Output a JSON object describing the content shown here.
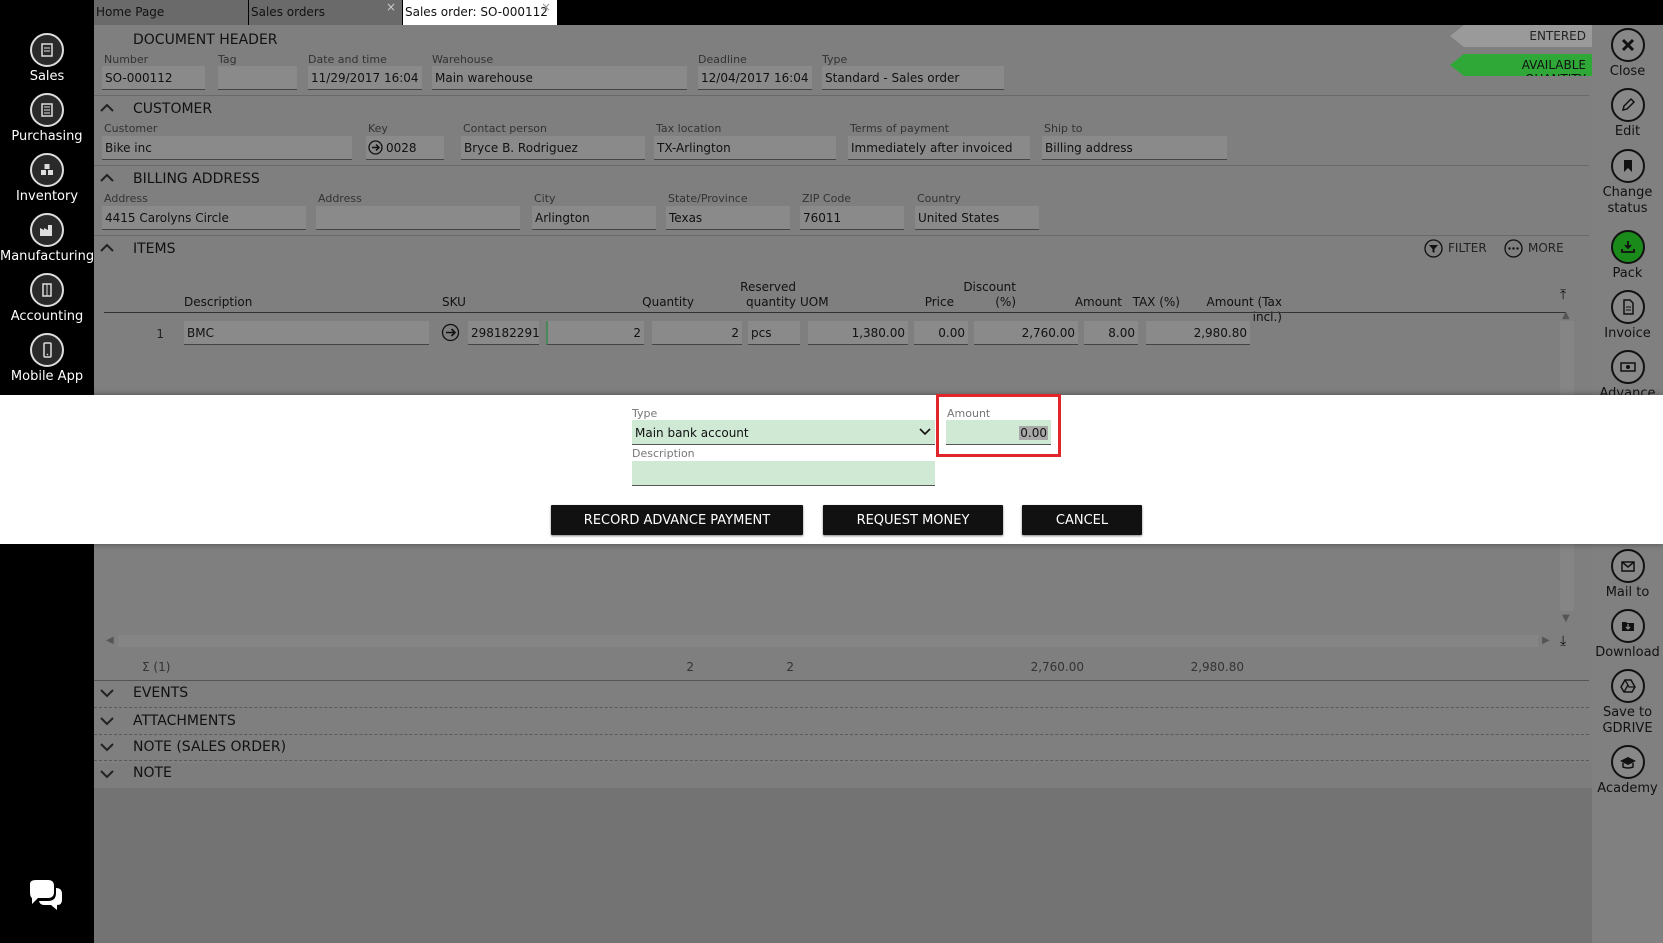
{
  "sidebar": {
    "items": [
      {
        "label": "Sales",
        "icon": "sales-icon"
      },
      {
        "label": "Purchasing",
        "icon": "purchasing-icon"
      },
      {
        "label": "Inventory",
        "icon": "inventory-icon"
      },
      {
        "label": "Manufacturing",
        "icon": "manufacturing-icon"
      },
      {
        "label": "Accounting",
        "icon": "accounting-icon"
      },
      {
        "label": "Mobile App",
        "icon": "mobile-icon"
      }
    ]
  },
  "tabs": [
    {
      "label": "Home Page"
    },
    {
      "label": "Sales orders",
      "close": "×"
    },
    {
      "label": "Sales order: SO-000112",
      "close": "×"
    }
  ],
  "status": {
    "entered": "ENTERED",
    "available": "AVAILABLE QUANTITY"
  },
  "colors": {
    "accent_green": "#2fa838",
    "highlight_red": "#e0262b",
    "field_green": "#cfe9d5"
  },
  "header": {
    "title": "DOCUMENT HEADER",
    "number_label": "Number",
    "number": "SO-000112",
    "tag_label": "Tag",
    "tag": "",
    "datetime_label": "Date and time",
    "datetime": "11/29/2017 16:04",
    "warehouse_label": "Warehouse",
    "warehouse": "Main warehouse",
    "deadline_label": "Deadline",
    "deadline": "12/04/2017 16:04",
    "type_label": "Type",
    "type": "Standard - Sales order"
  },
  "customer": {
    "title": "CUSTOMER",
    "customer_label": "Customer",
    "customer": "Bike inc",
    "key_label": "Key",
    "key": "0028",
    "contact_label": "Contact person",
    "contact": "Bryce B. Rodriguez",
    "tax_label": "Tax location",
    "tax": "TX-Arlington",
    "terms_label": "Terms of payment",
    "terms": "Immediately after invoiced",
    "ship_label": "Ship to",
    "ship": "Billing address"
  },
  "billing": {
    "title": "BILLING ADDRESS",
    "address_label": "Address",
    "address": "4415 Carolyns Circle",
    "address2_label": "Address",
    "address2": "",
    "city_label": "City",
    "city": "Arlington",
    "state_label": "State/Province",
    "state": "Texas",
    "zip_label": "ZIP Code",
    "zip": "76011",
    "country_label": "Country",
    "country": "United States"
  },
  "items": {
    "title": "ITEMS",
    "filter": "FILTER",
    "more": "MORE",
    "columns": {
      "description": "Description",
      "sku": "SKU",
      "quantity": "Quantity",
      "reserved1": "Reserved",
      "reserved2": "quantity",
      "uom": "UOM",
      "price": "Price",
      "discount1": "Discount",
      "discount2": "(%)",
      "amount": "Amount",
      "tax": "TAX (%)",
      "amount_tax": "Amount (Tax incl.)"
    },
    "rows": [
      {
        "num": "1",
        "description": "BMC",
        "sku": "298182291",
        "quantity": "2",
        "reserved": "2",
        "uom": "pcs",
        "price": "1,380.00",
        "discount": "0.00",
        "amount": "2,760.00",
        "tax": "8.00",
        "amount_tax": "2,980.80"
      }
    ],
    "totals": {
      "label": "Σ (1)",
      "quantity": "2",
      "reserved": "2",
      "amount": "2,760.00",
      "amount_tax": "2,980.80"
    }
  },
  "sections": {
    "events": "EVENTS",
    "attachments": "ATTACHMENTS",
    "note_so": "NOTE (SALES ORDER)",
    "note": "NOTE"
  },
  "actions": [
    {
      "label": "Close"
    },
    {
      "label": "Edit"
    },
    {
      "label": "Change status"
    },
    {
      "label": "Pack"
    },
    {
      "label": "Invoice"
    },
    {
      "label": "Advance"
    },
    {
      "label": "Mail to"
    },
    {
      "label": "Download"
    },
    {
      "label": "Save to GDRIVE"
    },
    {
      "label": "Academy"
    }
  ],
  "modal": {
    "type_label": "Type",
    "type_value": "Main bank account",
    "amount_label": "Amount",
    "amount_value": "0.00",
    "description_label": "Description",
    "description_value": "",
    "record_button": "RECORD ADVANCE PAYMENT",
    "request_button": "REQUEST MONEY",
    "cancel_button": "CANCEL"
  }
}
